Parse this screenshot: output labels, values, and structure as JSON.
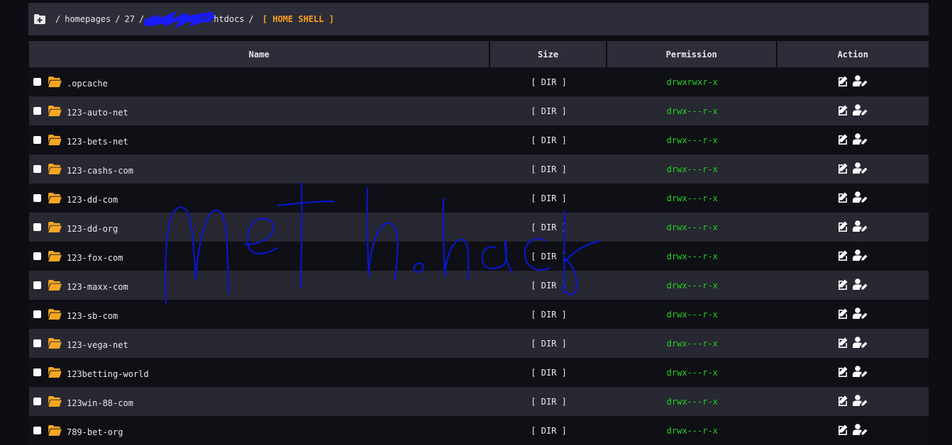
{
  "breadcrumb": {
    "segments": [
      "homepages",
      "27",
      "htdocs"
    ],
    "separator": "/",
    "current": "[ HOME SHELL ]"
  },
  "table": {
    "headers": {
      "name": "Name",
      "size": "Size",
      "permission": "Permission",
      "action": "Action"
    },
    "rows": [
      {
        "name": ".opcache",
        "size": "[ DIR ]",
        "permission": "drwxrwxr-x"
      },
      {
        "name": "123-auto-net",
        "size": "[ DIR ]",
        "permission": "drwx---r-x"
      },
      {
        "name": "123-bets-net",
        "size": "[ DIR ]",
        "permission": "drwx---r-x"
      },
      {
        "name": "123-cashs-com",
        "size": "[ DIR ]",
        "permission": "drwx---r-x"
      },
      {
        "name": "123-dd-com",
        "size": "[ DIR ]",
        "permission": "drwx---r-x"
      },
      {
        "name": "123-dd-org",
        "size": "[ DIR ]",
        "permission": "drwx---r-x"
      },
      {
        "name": "123-fox-com",
        "size": "[ DIR ]",
        "permission": "drwx---r-x"
      },
      {
        "name": "123-maxx-com",
        "size": "[ DIR ]",
        "permission": "drwx---r-x"
      },
      {
        "name": "123-sb-com",
        "size": "[ DIR ]",
        "permission": "drwx---r-x"
      },
      {
        "name": "123-vega-net",
        "size": "[ DIR ]",
        "permission": "drwx---r-x"
      },
      {
        "name": "123betting-world",
        "size": "[ DIR ]",
        "permission": "drwx---r-x"
      },
      {
        "name": "123win-88-com",
        "size": "[ DIR ]",
        "permission": "drwx---r-x"
      },
      {
        "name": "789-bet-org",
        "size": "[ DIR ]",
        "permission": "drwx---r-x"
      }
    ]
  },
  "colors": {
    "accent": "#ff9e1b",
    "permission": "#22d11e",
    "folder": "#f5a623",
    "header_bg": "#2c2d38",
    "scribble": "#0a16c8"
  },
  "icons": {
    "breadcrumb": "folder-plus-icon",
    "row": "folder-open-icon",
    "edit": "edit-icon",
    "chown": "user-edit-icon"
  }
}
